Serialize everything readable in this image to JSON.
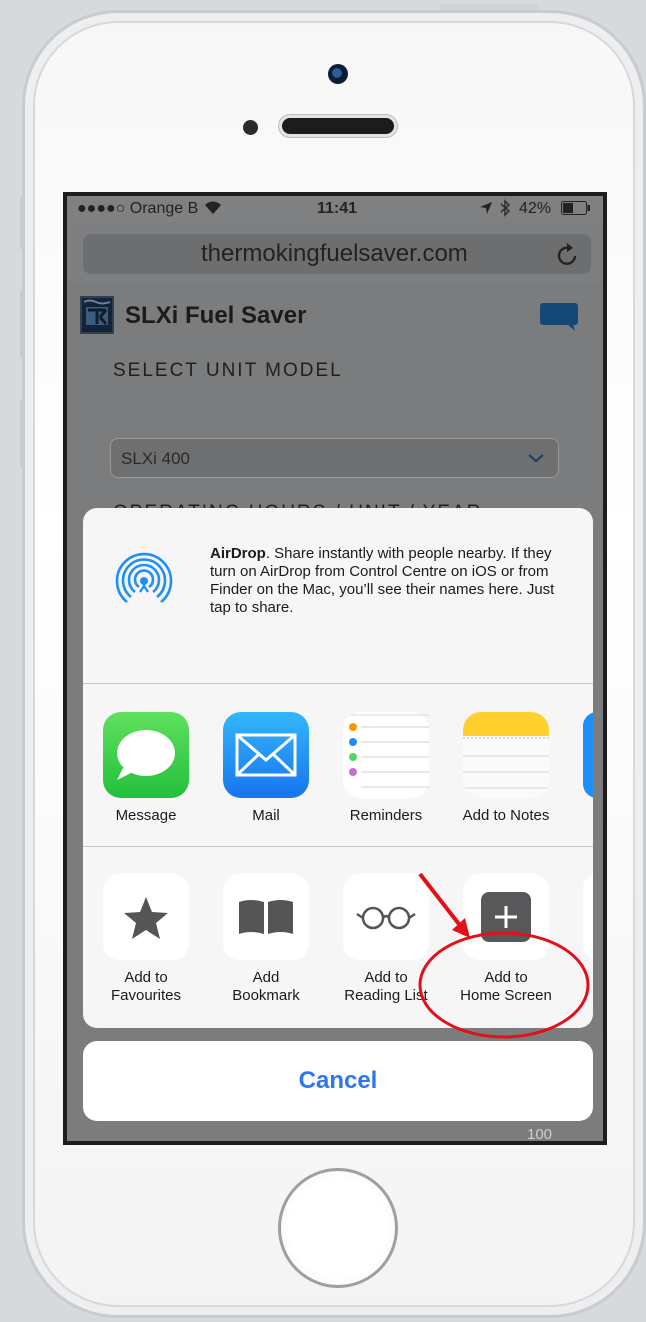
{
  "status_bar": {
    "carrier": "●●●●○ Orange B",
    "time": "11:41",
    "battery": "42%",
    "icons": [
      "wifi-icon",
      "location-arrow-icon",
      "bluetooth-icon",
      "battery-icon"
    ]
  },
  "browser": {
    "url": "thermokingfuelsaver.com",
    "reload_icon": "reload-icon"
  },
  "webpage": {
    "app_title": "SLXi Fuel Saver",
    "section_label": "SELECT UNIT MODEL",
    "unit_model_value": "SLXi 400",
    "partial_label": "OPERATING HOURS / UNIT / YEAR",
    "bottom_number": "100"
  },
  "share_sheet": {
    "airdrop": {
      "title": "AirDrop",
      "text": ". Share instantly with people nearby. If they turn on AirDrop from Control Centre on iOS or from Finder on the Mac, you’ll see their names here. Just tap to share."
    },
    "apps": [
      {
        "label": "Message",
        "icon": "message-icon",
        "color": "#3cd24f"
      },
      {
        "label": "Mail",
        "icon": "mail-icon",
        "color": "#1f8ff7"
      },
      {
        "label": "Reminders",
        "icon": "reminders-icon",
        "color": "#ffffff"
      },
      {
        "label": "Add to Notes",
        "icon": "notes-icon",
        "color": "#ffd43b"
      }
    ],
    "actions": [
      {
        "label_line1": "Add to",
        "label_line2": "Favourites",
        "icon": "star-icon"
      },
      {
        "label_line1": "Add",
        "label_line2": "Bookmark",
        "icon": "book-icon"
      },
      {
        "label_line1": "Add to",
        "label_line2": "Reading List",
        "icon": "glasses-icon"
      },
      {
        "label_line1": "Add to",
        "label_line2": "Home Screen",
        "icon": "plus-square-icon"
      }
    ],
    "cancel_label": "Cancel"
  },
  "annotation_color": "#e3101a",
  "accent_color": "#2b78f0"
}
